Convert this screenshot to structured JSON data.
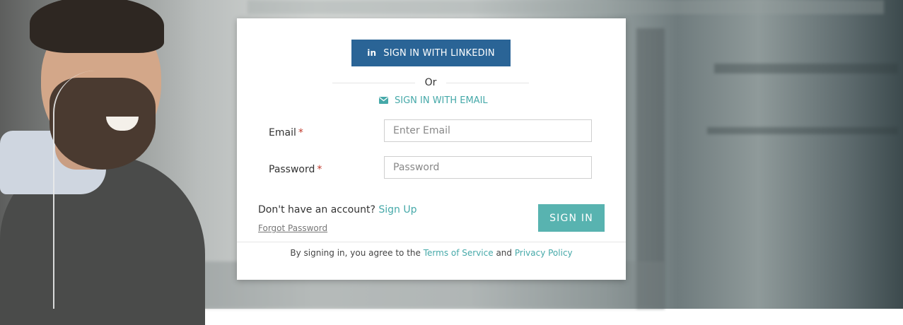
{
  "linkedin": {
    "icon": "linkedin-icon",
    "label": "SIGN IN WITH LINKEDIN",
    "color": "#2a6496"
  },
  "divider_text": "Or",
  "email_signin": {
    "icon": "envelope-icon",
    "label": "SIGN IN WITH EMAIL",
    "color": "#46a9a9"
  },
  "form": {
    "email": {
      "label": "Email",
      "required_mark": "*",
      "placeholder": "Enter Email",
      "value": ""
    },
    "password": {
      "label": "Password",
      "required_mark": "*",
      "placeholder": "Password",
      "value": ""
    }
  },
  "signup": {
    "prompt": "Don't have an account?",
    "link": "Sign Up"
  },
  "forgot": "Forgot Password",
  "submit": {
    "label": "SIGN IN",
    "color": "#58b3b0"
  },
  "terms": {
    "prefix": "By signing in, you agree to the",
    "tos": "Terms of Service",
    "and": "and",
    "privacy": "Privacy Policy"
  }
}
